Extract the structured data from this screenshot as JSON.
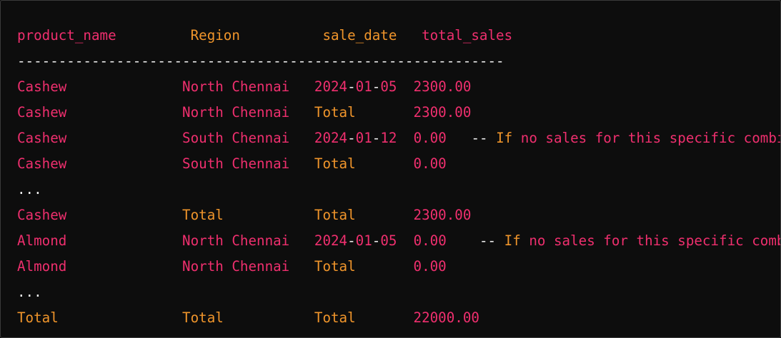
{
  "colors": {
    "background": "#0d0d0d",
    "pink": "#ef2f6e",
    "orange": "#f0952b",
    "white": "#f2f2f2"
  },
  "header": {
    "c1": "product_name",
    "c2": "Region",
    "c3": "sale_date",
    "c4": "total_sales"
  },
  "separator": "-----------------------------------------------------------",
  "rows": [
    {
      "product": "Cashew",
      "region": "North Chennai",
      "date_year": "2024",
      "date_month": "01",
      "date_day": "05",
      "total": "2300.00"
    },
    {
      "product": "Cashew",
      "region": "North Chennai",
      "date_label": "Total",
      "total": "2300.00"
    },
    {
      "product": "Cashew",
      "region": "South Chennai",
      "date_year": "2024",
      "date_month": "01",
      "date_day": "12",
      "total": "0.00",
      "comment_dashes": "--",
      "comment_if": "If",
      "comment_text": "no sales for this specific combination"
    },
    {
      "product": "Cashew",
      "region": "South Chennai",
      "date_label": "Total",
      "total": "0.00"
    },
    {
      "ellipsis": "..."
    },
    {
      "product": "Cashew",
      "region": "Total",
      "date_label": "Total",
      "total": "2300.00"
    },
    {
      "product": "Almond",
      "region": "North Chennai",
      "date_year": "2024",
      "date_month": "01",
      "date_day": "05",
      "total": "0.00",
      "comment_dashes": "--",
      "comment_if": "If",
      "comment_text": "no sales for this specific combination"
    },
    {
      "product": "Almond",
      "region": "North Chennai",
      "date_label": "Total",
      "total": "0.00"
    },
    {
      "ellipsis": "..."
    },
    {
      "product": "Total",
      "region": "Total",
      "date_label": "Total",
      "total": "22000.00"
    }
  ]
}
